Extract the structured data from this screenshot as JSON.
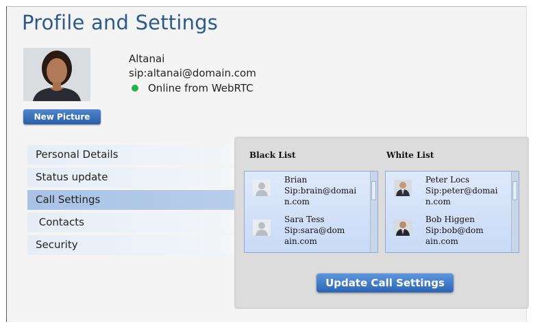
{
  "page": {
    "title": "Profile and Settings"
  },
  "profile": {
    "name": "Altanai",
    "sip": "sip:altanai@domain.com",
    "status": "Online from WebRTC",
    "status_color": "#22b14c",
    "new_picture_label": "New Picture"
  },
  "menu": {
    "items": [
      {
        "label": "Personal Details"
      },
      {
        "label": "Status update"
      },
      {
        "label": "Call Settings"
      },
      {
        "label": " Contacts"
      },
      {
        "label": "Security"
      }
    ],
    "active": "Call Settings"
  },
  "call_settings": {
    "black_list_title": "Black List",
    "white_list_title": "White List",
    "black_list": [
      {
        "name": "Brian",
        "sip1": "Sip:brain@domai",
        "sip2": "n.com",
        "icon": "person-placeholder-icon"
      },
      {
        "name": "Sara Tess",
        "sip1": "Sip:sara@dom",
        "sip2": "ain.com",
        "icon": "person-placeholder-icon"
      }
    ],
    "white_list": [
      {
        "name": "Peter Locs",
        "sip1": "Sip:peter@domai",
        "sip2": "n.com",
        "icon": "person-photo-icon"
      },
      {
        "name": "Bob Higgen",
        "sip1": "Sip:bob@dom",
        "sip2": "ain.com",
        "icon": "person-photo-icon"
      }
    ],
    "update_label": "Update Call Settings"
  }
}
